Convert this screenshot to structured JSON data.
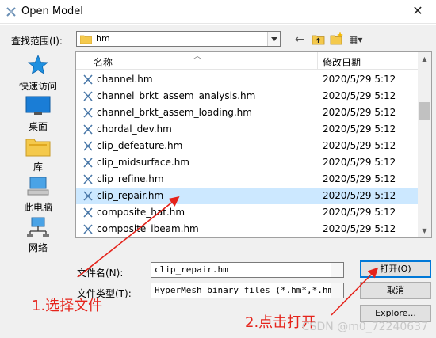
{
  "window": {
    "title": "Open Model",
    "close_glyph": "✕"
  },
  "lookin": {
    "label": "查找范围(I):",
    "value": "hm"
  },
  "toolbar": {
    "back_glyph": "←",
    "view_glyph": "▦▾"
  },
  "places": [
    {
      "label": "快速访问",
      "icon": "quick-access-star-icon"
    },
    {
      "label": "桌面",
      "icon": "desktop-icon"
    },
    {
      "label": "库",
      "icon": "library-folder-icon"
    },
    {
      "label": "此电脑",
      "icon": "this-pc-icon"
    },
    {
      "label": "网络",
      "icon": "network-icon"
    }
  ],
  "columns": {
    "name": "名称",
    "date": "修改日期"
  },
  "files": [
    {
      "name": "channel.hm",
      "date": "2020/5/29 5:12"
    },
    {
      "name": "channel_brkt_assem_analysis.hm",
      "date": "2020/5/29 5:12"
    },
    {
      "name": "channel_brkt_assem_loading.hm",
      "date": "2020/5/29 5:12"
    },
    {
      "name": "chordal_dev.hm",
      "date": "2020/5/29 5:12"
    },
    {
      "name": "clip_defeature.hm",
      "date": "2020/5/29 5:12"
    },
    {
      "name": "clip_midsurface.hm",
      "date": "2020/5/29 5:12"
    },
    {
      "name": "clip_refine.hm",
      "date": "2020/5/29 5:12"
    },
    {
      "name": "clip_repair.hm",
      "date": "2020/5/29 5:12"
    },
    {
      "name": "composite_hat.hm",
      "date": "2020/5/29 5:12"
    },
    {
      "name": "composite_ibeam.hm",
      "date": "2020/5/29 5:12"
    }
  ],
  "selected_index": 7,
  "filename": {
    "label": "文件名(N):",
    "value": "clip_repair.hm"
  },
  "filetype": {
    "label": "文件类型(T):",
    "value": "HyperMesh binary files (*.hm*,*.hm)"
  },
  "buttons": {
    "open": "打开(O)",
    "cancel": "取消",
    "explore": "Explore..."
  },
  "annotations": {
    "step1": "1.选择文件",
    "step2": "2.点击打开"
  },
  "watermark": "CSDN @m0_72240637",
  "colors": {
    "selection": "#cce8ff",
    "annotation": "#e5231b",
    "default_button_border": "#0078d7"
  }
}
